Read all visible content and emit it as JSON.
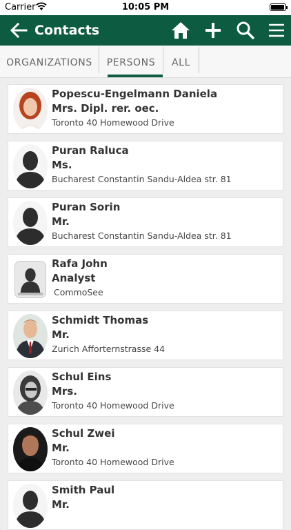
{
  "status": {
    "carrier": "Carrier",
    "time": "10:05 PM"
  },
  "navbar": {
    "title": "Contacts",
    "color": "#0d5c41",
    "icons": [
      "back-arrow-icon",
      "home-icon",
      "plus-icon",
      "search-icon",
      "menu-icon"
    ]
  },
  "tabs": [
    {
      "label": "ORGANIZATIONS",
      "active": false
    },
    {
      "label": "PERSONS",
      "active": true
    },
    {
      "label": "ALL",
      "active": false
    }
  ],
  "contacts": [
    {
      "name": "Popescu-Engelmann Daniela",
      "salutation": "Mrs. Dipl. rer. oec.",
      "address": "Toronto 40  Homewood Drive",
      "avatar": "photo-woman-red-hair"
    },
    {
      "name": "Puran Raluca",
      "salutation": "Ms.",
      "address": "Bucharest Constantin Sandu-Aldea str. 81",
      "avatar": "placeholder-silhouette"
    },
    {
      "name": "Puran Sorin",
      "salutation": "Mr.",
      "address": "Bucharest Constantin Sandu-Aldea str. 81",
      "avatar": "placeholder-silhouette"
    },
    {
      "name": "Rafa John",
      "salutation": " Analyst",
      "address": "CommoSee",
      "avatar": "placeholder-contact-card"
    },
    {
      "name": "Schmidt Thomas",
      "salutation": "Mr.",
      "address": "Zurich Afforternstrasse 44",
      "avatar": "photo-man-suit"
    },
    {
      "name": "Schul Eins",
      "salutation": "Mrs.",
      "address": "Toronto 40  Homewood Drive",
      "avatar": "photo-woman-glasses"
    },
    {
      "name": "Schul Zwei",
      "salutation": "Mr.",
      "address": "Toronto 40  Homewood Drive",
      "avatar": "photo-man-dark"
    },
    {
      "name": "Smith Paul",
      "salutation": "Mr.",
      "address": "",
      "avatar": "placeholder-silhouette"
    }
  ]
}
